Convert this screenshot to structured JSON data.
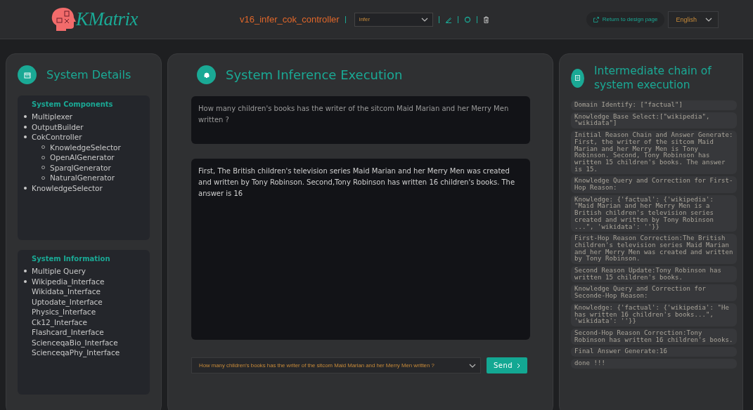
{
  "header": {
    "logo_text": "KMatrix",
    "system_name": "v16_infer_cok_controller",
    "mode_select": {
      "value": "infer"
    },
    "return_button": "Return to design page",
    "language_select": {
      "value": "English"
    }
  },
  "details_panel": {
    "title": "System Details",
    "components": {
      "title": "System Components",
      "items": [
        {
          "label": "Multiplexer"
        },
        {
          "label": "OutputBuilder"
        },
        {
          "label": "CokController",
          "children": [
            {
              "label": "KnowledgeSelector"
            },
            {
              "label": "OpenAIGenerator"
            },
            {
              "label": "SparqlGenerator"
            },
            {
              "label": "NaturalGenerator"
            }
          ]
        },
        {
          "label": "KnowledgeSelector"
        }
      ]
    },
    "information": {
      "title": "System Information",
      "items": [
        {
          "label": "Multiple Query",
          "bullet": true
        },
        {
          "label": "Wikipedia_Interface",
          "bullet": true
        },
        {
          "label": "Wikidata_Interface",
          "bullet": false
        },
        {
          "label": "Uptodate_Interface",
          "bullet": false
        },
        {
          "label": "Physics_Interface",
          "bullet": false
        },
        {
          "label": "Ck12_Interface",
          "bullet": false
        },
        {
          "label": "Flashcard_Interface",
          "bullet": false
        },
        {
          "label": "ScienceqaBio_Interface",
          "bullet": false
        },
        {
          "label": "ScienceqaPhy_Interface",
          "bullet": false
        }
      ]
    }
  },
  "inference_panel": {
    "title": "System Inference Execution",
    "question": "How many children's books has the writer of the sitcom Maid Marian and her Merry Men written ?",
    "answer": "First,   The British children's television series Maid Marian and her Merry Men was created and written by Tony Robinson. Second,Tony Robinson has written 16 children's books. The answer is 16",
    "query_select": {
      "value": "How many children's books has the writer of the sitcom Maid Marian and her Merry Men written ?"
    },
    "send_button": "Send"
  },
  "chain_panel": {
    "title": "Intermediate chain of system execution",
    "steps": [
      "Domain Identify: [\"factual\"]",
      "Knowledge Base Select:[\"wikipedia\", \"wikidata\"]",
      "Initial Reason Chain and Answer Generate: First, the writer of the sitcom Maid Marian and her Merry Men is Tony Robinson. Second, Tony Robinson has written 15 children's books. The answer is 15.",
      "Knowledge Query and Correction for First-Hop Reason:",
      "Knowledge: {'factual': {'wikipedia': \"Maid Marian and her Merry Men is a British children's television series created and written by Tony Robinson ...\", 'wikidata': ''}}",
      "First-Hop Reason Correction:The British children's television series Maid Marian and her Merry Men was created and written by Tony Robinson.",
      "Second Reason Update:Tony Robinson has written 15 children's books.",
      "Knowledge Query and Correction for Seconde-Hop Reason:",
      "Knowledge: {'factual': {'wikipedia': \"He has written 16 children's books...\", 'wikidata': ''}}",
      "Second-Hop Reason Correction:Tony Robinson has written 16 children's books.",
      "Final Answer Generate:16",
      "done !!!"
    ]
  }
}
